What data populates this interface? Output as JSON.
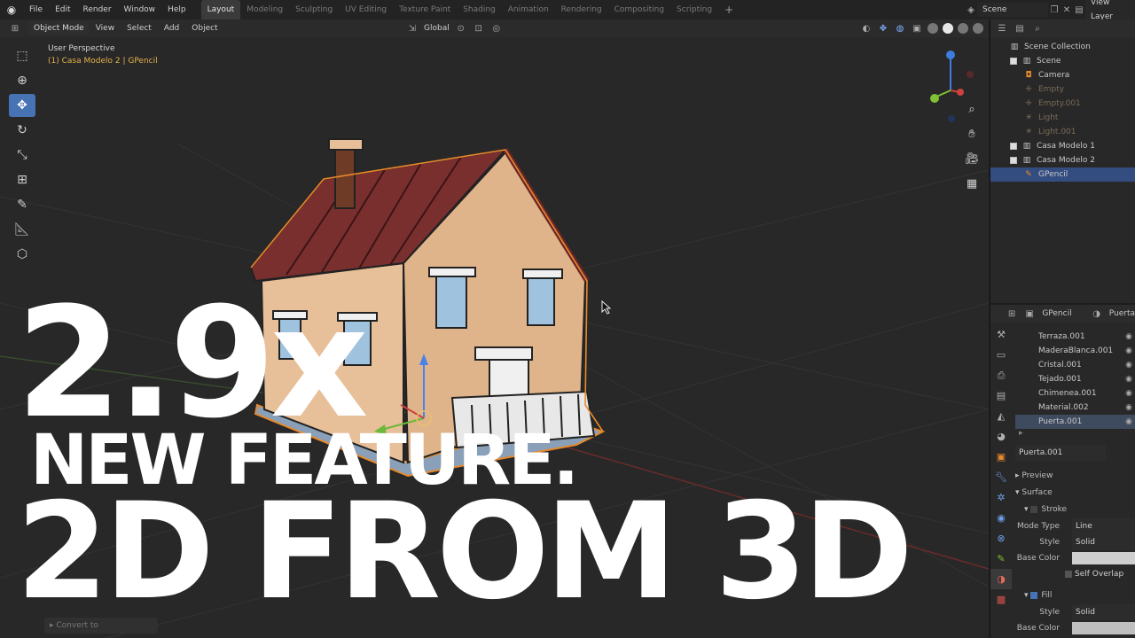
{
  "topbar": {
    "menu": [
      "File",
      "Edit",
      "Render",
      "Window",
      "Help"
    ],
    "workspaces": [
      "Layout",
      "Modeling",
      "Sculpting",
      "UV Editing",
      "Texture Paint",
      "Shading",
      "Animation",
      "Rendering",
      "Compositing",
      "Scripting"
    ],
    "add_workspace": "+",
    "scene": "Scene",
    "view_layer": "View Layer"
  },
  "viewport": {
    "mode": "Object Mode",
    "menu": [
      "View",
      "Select",
      "Add",
      "Object"
    ],
    "transform_orientation": "Global",
    "view_name": "User Perspective",
    "active_object": "(1) Casa Modelo 2 | GPencil",
    "operator_panel": "Convert to"
  },
  "overlay_title": {
    "line1": "2.9x",
    "line2": "NEW FEATURE.",
    "line3": "2D FROM 3D"
  },
  "outliner": {
    "root": "Scene Collection",
    "items": [
      {
        "label": "Scene",
        "level": 1,
        "icon": "collection-icon",
        "dim": false,
        "selected": false
      },
      {
        "label": "Camera",
        "level": 2,
        "icon": "camera-icon",
        "dim": false,
        "selected": false
      },
      {
        "label": "Empty",
        "level": 2,
        "icon": "empty-icon",
        "dim": true,
        "selected": false
      },
      {
        "label": "Empty.001",
        "level": 2,
        "icon": "empty-icon",
        "dim": true,
        "selected": false
      },
      {
        "label": "Light",
        "level": 2,
        "icon": "light-icon",
        "dim": true,
        "selected": false
      },
      {
        "label": "Light.001",
        "level": 2,
        "icon": "light-icon",
        "dim": true,
        "selected": false
      },
      {
        "label": "Casa Modelo 1",
        "level": 1,
        "icon": "collection-icon",
        "dim": false,
        "selected": false
      },
      {
        "label": "Casa Modelo 2",
        "level": 1,
        "icon": "collection-icon",
        "dim": false,
        "selected": false
      },
      {
        "label": "GPencil",
        "level": 2,
        "icon": "grease-pencil-icon",
        "dim": false,
        "selected": true
      }
    ]
  },
  "properties": {
    "object_name": "GPencil",
    "material_header": "Puerta",
    "material_slots": [
      "Terraza.001",
      "MaderaBlanca.001",
      "Cristal.001",
      "Tejado.001",
      "Chimenea.001",
      "Material.002",
      "Puerta.001"
    ],
    "selected_slot": "Puerta.001",
    "active_material": "Puerta.001",
    "sections": {
      "preview": "Preview",
      "surface": "Surface",
      "stroke": "Stroke",
      "fill": "Fill"
    },
    "stroke": {
      "mode_type_label": "Mode Type",
      "mode_type_value": "Line",
      "style_label": "Style",
      "style_value": "Solid",
      "base_color_label": "Base Color",
      "self_overlap_label": "Self Overlap"
    },
    "fill": {
      "style_label": "Style",
      "style_value": "Solid",
      "base_color_label": "Base Color"
    }
  },
  "colors": {
    "accent": "#4772b3",
    "selection_outline": "#e8892a",
    "wall": "#e7bf98",
    "roof": "#7a2f2f",
    "window_glass": "#9fc2df"
  }
}
